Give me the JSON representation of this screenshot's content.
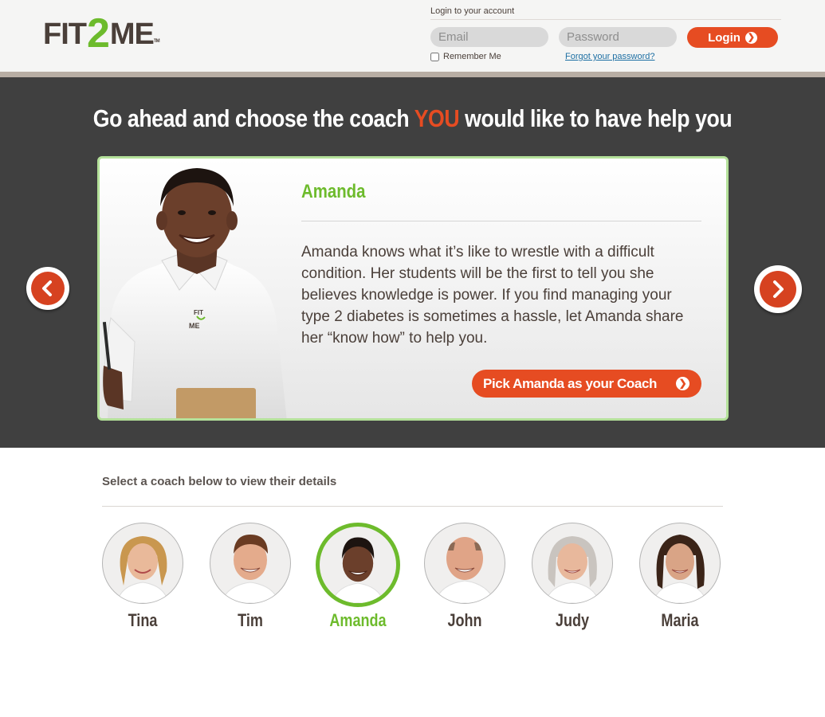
{
  "header": {
    "logo_left": "FIT",
    "logo_two": "2",
    "logo_right": "ME",
    "logo_tm": "TM",
    "login_title": "Login to your account",
    "email_placeholder": "Email",
    "password_placeholder": "Password",
    "login_label": "Login",
    "remember_label": "Remember Me",
    "forgot_label": "Forgot your password?"
  },
  "hero": {
    "title_before": "Go ahead and choose the coach ",
    "title_emphasis": "YOU",
    "title_after": " would like to have help you"
  },
  "featured_coach": {
    "name": "Amanda",
    "bio": "Amanda knows what it’s like to wrestle with a difficult condition. Her students will be the first to tell you she believes knowledge is power. If you find managing your type 2 diabetes is sometimes a hassle, let Amanda share her “know how” to help you.",
    "pick_label": "Pick Amanda as your Coach",
    "shirt_logo_1": "FIT",
    "shirt_logo_2": "ME"
  },
  "selector": {
    "label": "Select a coach below to view their details",
    "coaches": [
      {
        "name": "Tina",
        "selected": false
      },
      {
        "name": "Tim",
        "selected": false
      },
      {
        "name": "Amanda",
        "selected": true
      },
      {
        "name": "John",
        "selected": false
      },
      {
        "name": "Judy",
        "selected": false
      },
      {
        "name": "Maria",
        "selected": false
      }
    ]
  },
  "colors": {
    "accent_orange": "#e64c22",
    "brand_green": "#6dbb2c",
    "hero_background": "#404040",
    "text_brown": "#4a3f39"
  },
  "icons": {
    "prev": "chevron-left-icon",
    "next": "chevron-right-icon",
    "button_arrow": "arrow-circle-right-icon"
  }
}
